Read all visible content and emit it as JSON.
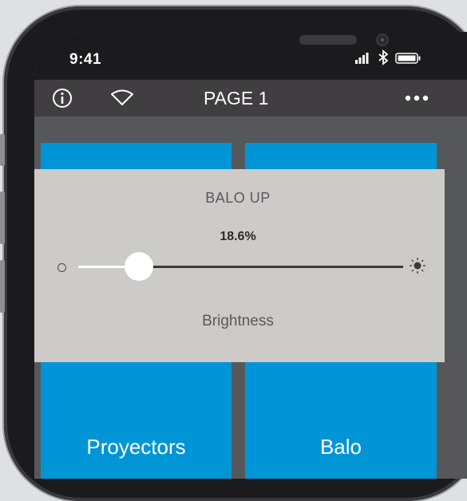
{
  "status_bar": {
    "time": "9:41",
    "icons": [
      "signal-icon",
      "bluetooth-icon",
      "battery-icon"
    ]
  },
  "header": {
    "title": "PAGE 1",
    "icons": [
      "info-icon",
      "wifi-icon",
      "more-icon"
    ]
  },
  "tiles": [
    {
      "label": ""
    },
    {
      "label": ""
    },
    {
      "label": "Proyectors"
    },
    {
      "label": "Balo"
    }
  ],
  "dimmer_popup": {
    "title": "BALO UP",
    "value_text": "18.6%",
    "level": 0.186,
    "caption": "Brightness",
    "min_icon": "brightness-low-icon",
    "max_icon": "brightness-high-icon"
  },
  "colors": {
    "tile": "#0095d6",
    "header": "#403e40",
    "popup": "#cccbc8",
    "background": "#55575b"
  }
}
